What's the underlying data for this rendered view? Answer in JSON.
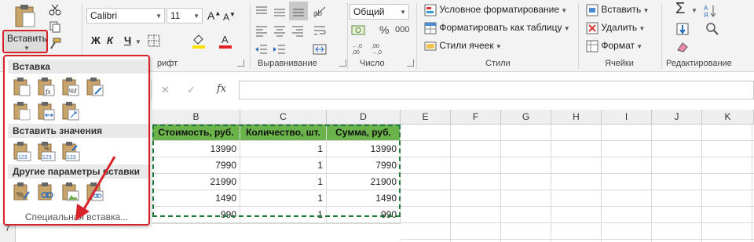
{
  "ribbon": {
    "paste_label": "Вставить",
    "font_name": "Calibri",
    "font_size": "11",
    "bold": "Ж",
    "italic": "К",
    "underline": "Ч",
    "font_group_partial": "рифт",
    "alignment_group": "Выравнивание",
    "number_format": "Общий",
    "percent": "%",
    "thousands": "000",
    "number_group": "Число",
    "conditional_formatting": "Условное форматирование",
    "format_as_table": "Форматировать как таблицу",
    "cell_styles": "Стили ячеек",
    "styles_group": "Стили",
    "insert": "Вставить",
    "delete": "Удалить",
    "format": "Формат",
    "cells_group": "Ячейки",
    "editing_group": "Редактирование"
  },
  "formula_bar": {
    "fx": "fx",
    "cancel": "✕",
    "confirm": "✓"
  },
  "columns": [
    "B",
    "C",
    "D",
    "E",
    "F",
    "G",
    "H",
    "I",
    "J",
    "K"
  ],
  "table": {
    "headers": [
      "Стоимость, руб.",
      "Количество, шт.",
      "Сумма, руб."
    ],
    "rows": [
      [
        "13990",
        "1",
        "13990"
      ],
      [
        "7990",
        "1",
        "7990"
      ],
      [
        "21990",
        "1",
        "21900"
      ],
      [
        "1490",
        "1",
        "1490"
      ],
      [
        "990",
        "1",
        "990"
      ]
    ]
  },
  "row_number_visible": "7",
  "paste_menu": {
    "section_paste": "Вставка",
    "section_values": "Вставить значения",
    "section_other": "Другие параметры вставки",
    "special_paste": "Специальная вставка..."
  },
  "colors": {
    "header_fill": "#6ab24a",
    "highlight": "#d9232a",
    "marquee": "#1e7a3b"
  }
}
